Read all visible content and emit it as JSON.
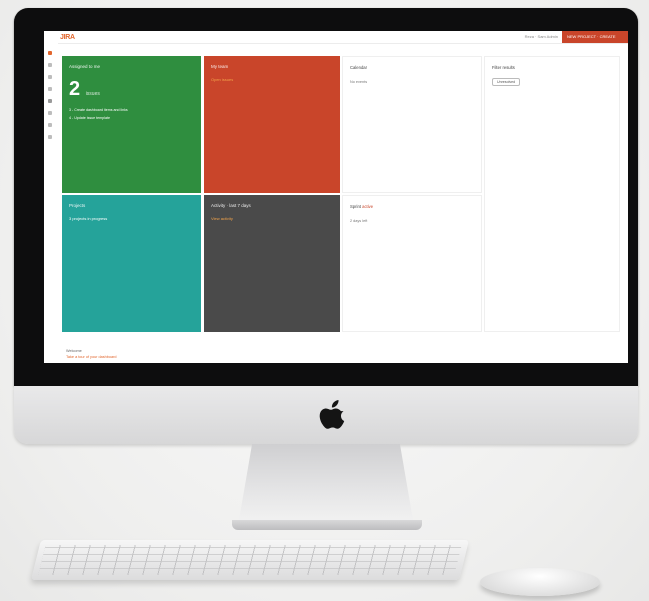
{
  "app": {
    "logo_text": "JIRA"
  },
  "topbar": {
    "user_label": "Reza · Sam Admin",
    "cta_label": "NEW PROJECT · CREATE"
  },
  "tiles": {
    "green": {
      "title": "Assigned to me",
      "big_number": "2",
      "unit": "issues",
      "line1": "3 - Create dashboard items and links",
      "line2": "4 - Update issue template"
    },
    "orange": {
      "title": "My team",
      "subtitle": "Open issues"
    },
    "teal": {
      "title": "Projects",
      "subtitle": "3 projects in progress"
    },
    "gray": {
      "title": "Activity · last 7 days",
      "subtitle": "View activity"
    }
  },
  "panels": {
    "p1": {
      "title": "Calendar",
      "text": "No events"
    },
    "p2": {
      "title_prefix": "Sprint",
      "title_highlight": "active",
      "text": "2 days left"
    },
    "p3": {
      "title": "Filter results",
      "pill_label": "Unresolved"
    }
  },
  "footer": {
    "line1": "Welcome",
    "link": "Take a tour of your dashboard"
  },
  "colors": {
    "green": "#2f8e3f",
    "orange": "#c9452a",
    "teal": "#25a39a",
    "gray": "#4a4a4a",
    "accent": "#e2662d"
  },
  "icons": {
    "apple": "apple-logo",
    "sidebar": [
      "home-icon",
      "search-icon",
      "plus-icon",
      "board-icon",
      "chart-icon",
      "settings-icon",
      "help-icon",
      "user-icon"
    ]
  }
}
